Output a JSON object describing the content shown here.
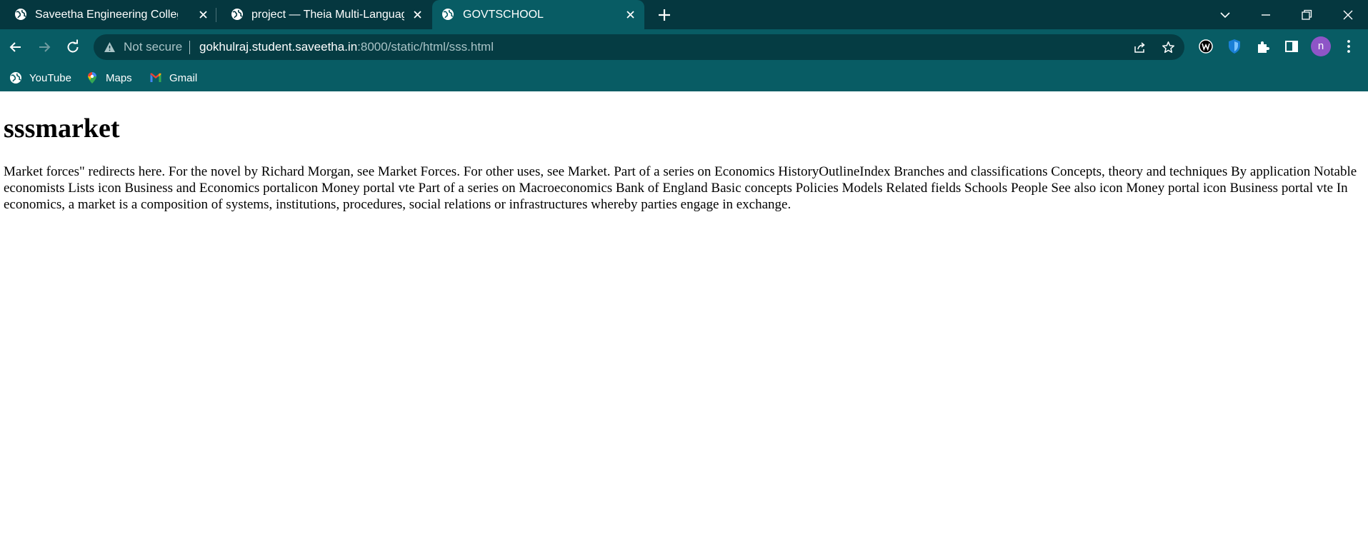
{
  "browser": {
    "tabs": [
      {
        "title": "Saveetha Engineering College",
        "active": false
      },
      {
        "title": "project — Theia Multi-Language",
        "active": false
      },
      {
        "title": "GOVTSCHOOL",
        "active": true
      }
    ],
    "address_bar": {
      "security_text": "Not secure",
      "url_host": "gokhulraj.student.saveetha.in",
      "url_path": ":8000/static/html/sss.html"
    },
    "profile_initial": "n",
    "bookmarks": [
      {
        "label": "YouTube",
        "icon": "globe-icon"
      },
      {
        "label": "Maps",
        "icon": "maps-pin-icon"
      },
      {
        "label": "Gmail",
        "icon": "gmail-icon"
      }
    ],
    "colors": {
      "tabstrip": "#05373f",
      "toolbar": "#085c64",
      "omnibox": "#053c43",
      "avatar": "#8e55c7"
    }
  },
  "page": {
    "heading": "sssmarket",
    "body": "Market forces\" redirects here. For the novel by Richard Morgan, see Market Forces. For other uses, see Market. Part of a series on Economics HistoryOutlineIndex Branches and classifications Concepts, theory and techniques By application Notable economists Lists icon Business and Economics portalicon Money portal vte Part of a series on Macroeconomics Bank of England Basic concepts Policies Models Related fields Schools People See also icon Money portal icon Business portal vte In economics, a market is a composition of systems, institutions, procedures, social relations or infrastructures whereby parties engage in exchange."
  }
}
